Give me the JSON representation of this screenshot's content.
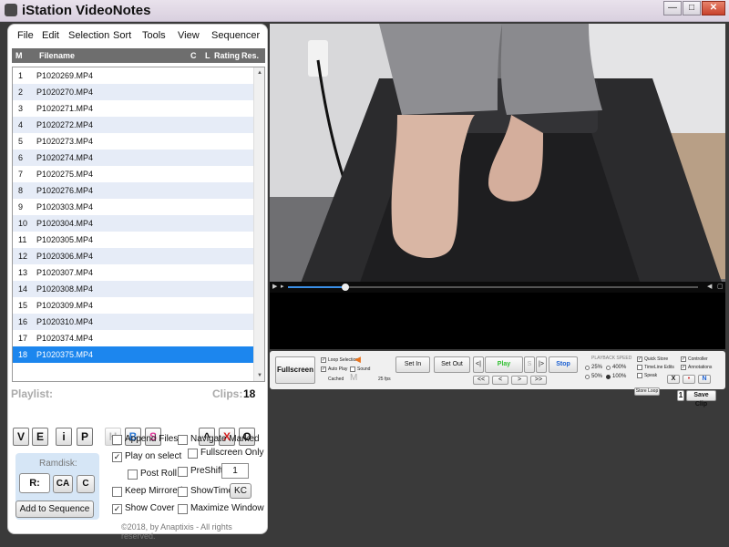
{
  "window": {
    "title": "iStation VideoNotes",
    "buttons": [
      "—",
      "□",
      "✕"
    ]
  },
  "menu": [
    "File",
    "Edit",
    "Selection",
    "Sort",
    "Tools",
    "View",
    "Sequencer"
  ],
  "list_headers": {
    "mark": "M",
    "filename": "Filename",
    "c": "C",
    "l": "L",
    "rating": "Rating",
    "res": "Res."
  },
  "files": [
    {
      "n": "1",
      "name": "P1020269.MP4"
    },
    {
      "n": "2",
      "name": "P1020270.MP4"
    },
    {
      "n": "3",
      "name": "P1020271.MP4"
    },
    {
      "n": "4",
      "name": "P1020272.MP4"
    },
    {
      "n": "5",
      "name": "P1020273.MP4"
    },
    {
      "n": "6",
      "name": "P1020274.MP4"
    },
    {
      "n": "7",
      "name": "P1020275.MP4"
    },
    {
      "n": "8",
      "name": "P1020276.MP4"
    },
    {
      "n": "9",
      "name": "P1020303.MP4"
    },
    {
      "n": "10",
      "name": "P1020304.MP4"
    },
    {
      "n": "11",
      "name": "P1020305.MP4"
    },
    {
      "n": "12",
      "name": "P1020306.MP4"
    },
    {
      "n": "13",
      "name": "P1020307.MP4"
    },
    {
      "n": "14",
      "name": "P1020308.MP4"
    },
    {
      "n": "15",
      "name": "P1020309.MP4"
    },
    {
      "n": "16",
      "name": "P1020310.MP4"
    },
    {
      "n": "17",
      "name": "P1020374.MP4"
    },
    {
      "n": "18",
      "name": "P1020375.MP4"
    }
  ],
  "selected_file_index": 17,
  "playlist": {
    "label": "Playlist:",
    "clips_label": "Clips:",
    "clips_count": "18",
    "buttons": [
      "V",
      "E",
      "i",
      "P",
      "H",
      "B",
      "S",
      "^",
      "X",
      "O"
    ]
  },
  "ramdisk": {
    "label": "Ramdisk:",
    "r": "R:",
    "ca": "CA",
    "c": "C",
    "value": "--"
  },
  "options": {
    "append_files": "Append Files",
    "navigate_marked": "Navigate Marked",
    "play_on_select": "Play on select",
    "fullscreen_only": "Fullscreen Only",
    "post_roll": "Post Roll",
    "preshift": "PreShift",
    "preshift_value": "1",
    "keep_mirrored": "Keep Mirrored",
    "showtime": "ShowTime",
    "kc": "KC",
    "show_cover": "Show Cover",
    "maximize_window": "Maximize Window",
    "checked": [
      "play_on_select",
      "show_cover"
    ]
  },
  "add_to_sequence": "Add to Sequence",
  "copyright": "©2018, by Anaptixis - All rights reserved.",
  "video": {
    "progress": 0.14
  },
  "controls": {
    "fullscreen": "Fullscreen",
    "loop_selection": "Loop Selection",
    "auto_play": "Auto Play",
    "sound": "Sound",
    "cached": "Cached",
    "m": "M",
    "fps": "25 fps",
    "set_in": "Set In",
    "set_out": "Set Out",
    "prev": "<|",
    "play": "Play",
    "s": "S",
    "next": "|>",
    "stop": "Stop",
    "step_buttons": [
      "<<",
      "<",
      ">",
      ">>"
    ],
    "playback_speed": "PLAYBACK SPEED",
    "speeds": [
      "25%",
      "400%",
      "50%",
      "100%"
    ],
    "selected_speed": "100%",
    "quick_store": "Quick Store",
    "timeline_edits": "TimeLine Edits",
    "speak": "Speak",
    "controller": "Controller",
    "annotations": "Annotations",
    "x": "X",
    "dot": "•",
    "n": "N",
    "store_loop": "Store Loop",
    "save_clip_num": "1",
    "save_clip": "Save Clip"
  },
  "colors": {
    "selected_row": "#1c86ee",
    "alt_row": "#e6ecf7",
    "play_green": "#2fbf2f",
    "stop_blue": "#1a5fd1",
    "x_red": "#d21e1e",
    "b_blue": "#2d7ad6",
    "s_pink": "#e0399b"
  }
}
